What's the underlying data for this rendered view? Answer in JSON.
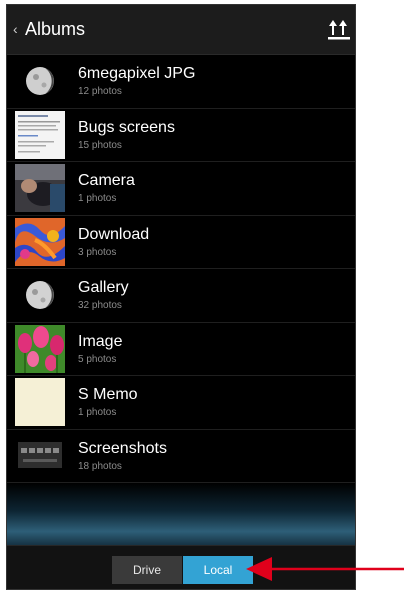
{
  "header": {
    "back_glyph": "‹",
    "title": "Albums",
    "sort_icon": "sort-arrows-icon"
  },
  "albums": [
    {
      "name": "6megapixel JPG",
      "count": "12 photos",
      "thumb": "moon"
    },
    {
      "name": "Bugs screens",
      "count": "15 photos",
      "thumb": "document"
    },
    {
      "name": "Camera",
      "count": "1 photos",
      "thumb": "photo"
    },
    {
      "name": "Download",
      "count": "3 photos",
      "thumb": "colorful"
    },
    {
      "name": "Gallery",
      "count": "32 photos",
      "thumb": "moon"
    },
    {
      "name": "Image",
      "count": "5 photos",
      "thumb": "tulips"
    },
    {
      "name": "S Memo",
      "count": "1 photos",
      "thumb": "memo"
    },
    {
      "name": "Screenshots",
      "count": "18 photos",
      "thumb": "screen"
    }
  ],
  "bottom_bar": {
    "drive_label": "Drive",
    "local_label": "Local",
    "selected": "Local"
  },
  "colors": {
    "accent": "#33a3d4",
    "annotation_arrow": "#e0001b",
    "background": "#000000"
  }
}
